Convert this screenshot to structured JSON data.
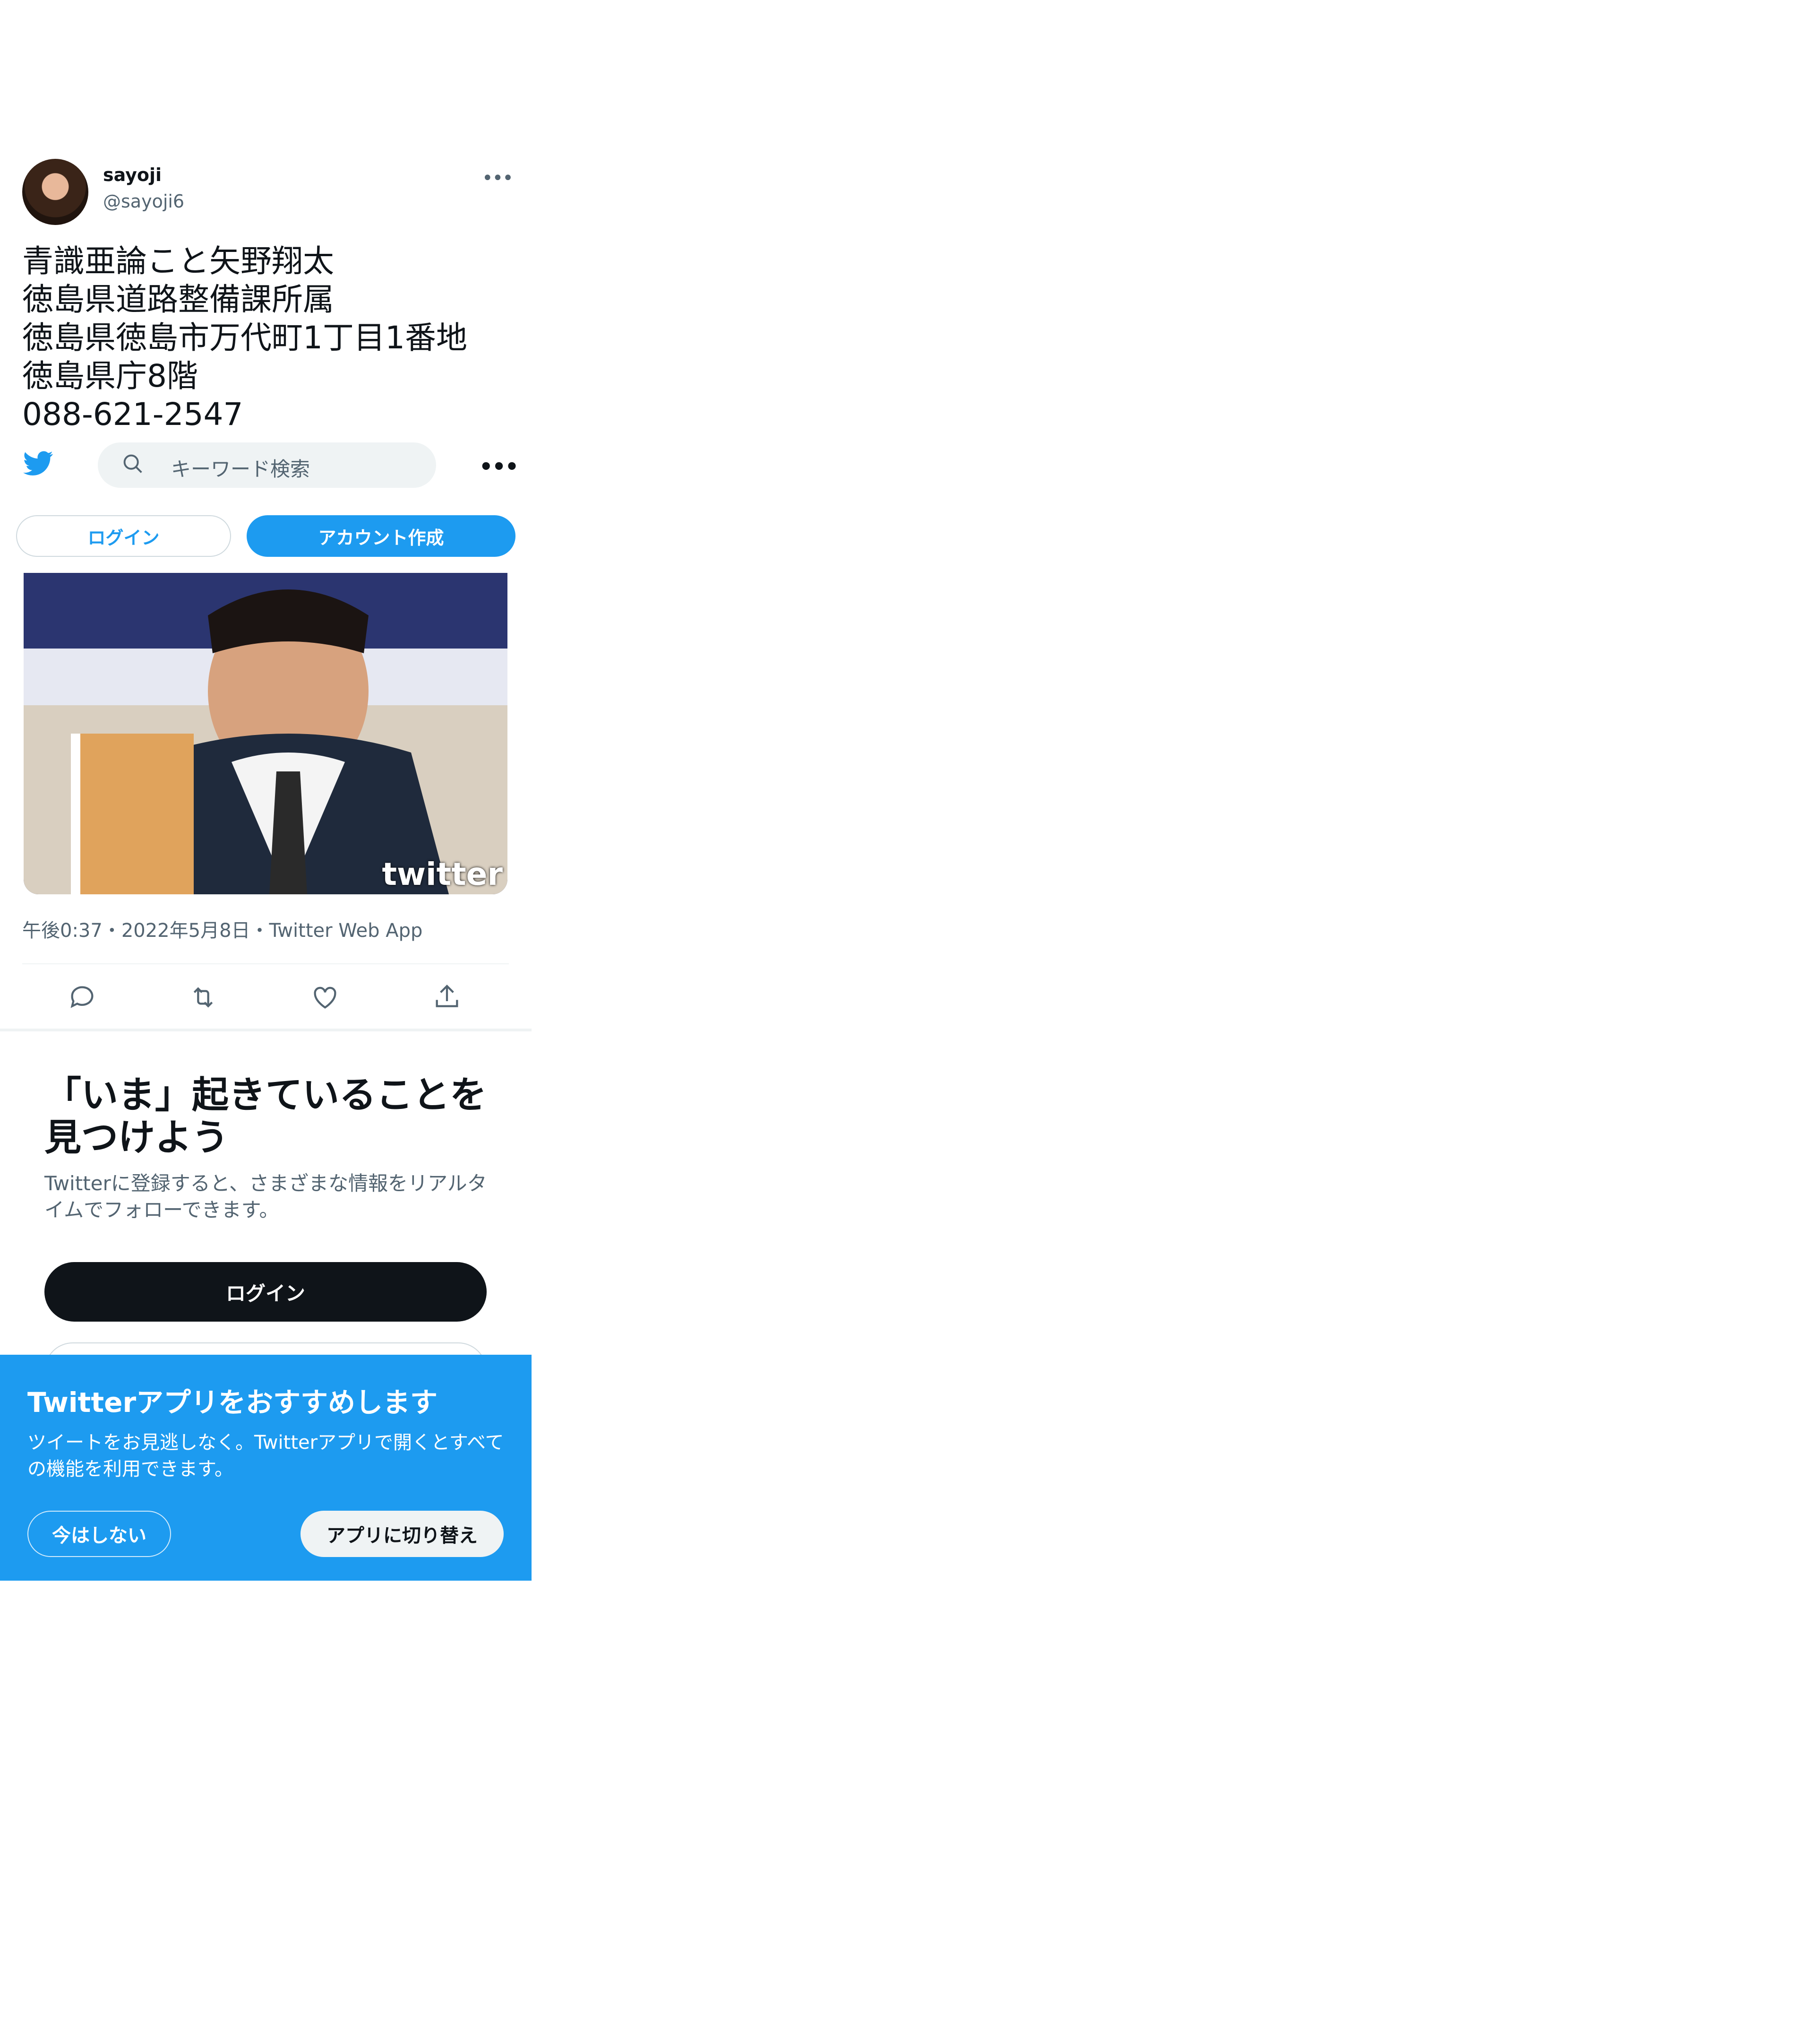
{
  "tweet": {
    "author_name": "sayoji",
    "author_handle": "@sayoji6",
    "more_icon": "•••",
    "text_lines": [
      "青識亜論こと矢野翔太",
      "徳島県道路整備課所属",
      "徳島県徳島市万代町1丁目1番地",
      "徳島県庁8階",
      "088-621-2547"
    ],
    "media_watermark": "twitter",
    "meta": "午後0:37・2022年5月8日・Twitter Web App"
  },
  "nav": {
    "search_placeholder": "キーワード検索",
    "more_icon": "•••",
    "login_label": "ログイン",
    "signup_label": "アカウント作成"
  },
  "promo": {
    "title": "「いま」起きていることを見つけよう",
    "subtitle": "Twitterに登録すると、さまざまな情報をリアルタイムでフォローできます。",
    "login_label": "ログイン"
  },
  "banner": {
    "title": "Twitterアプリをおすすめします",
    "subtitle": "ツイートをお見逃しなく。Twitterアプリで開くとすべての機能を利用できます。",
    "later_label": "今はしない",
    "switch_label": "アプリに切り替え"
  },
  "colors": {
    "accent": "#1d9bf0",
    "text": "#0f1419",
    "secondary": "#536471"
  }
}
